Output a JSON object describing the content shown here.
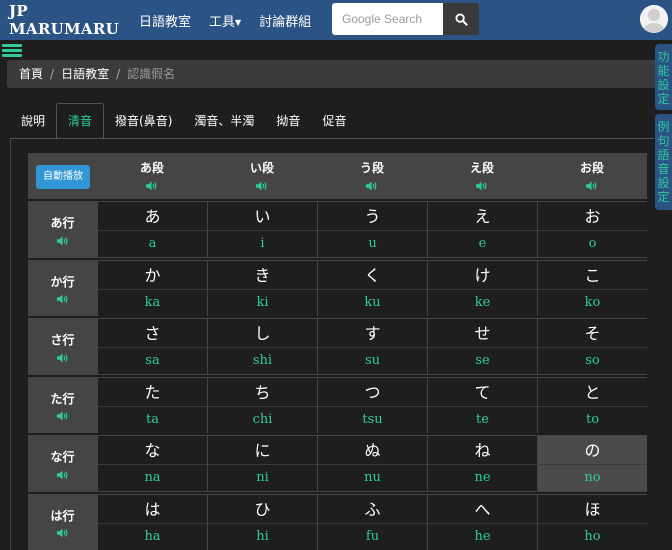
{
  "navbar": {
    "brand": "JP MARUMARU",
    "links": [
      "日語教室",
      "工具",
      "討論群組"
    ],
    "search_placeholder": "Google Search"
  },
  "breadcrumb": {
    "home": "首頁",
    "section": "日語教室",
    "current": "認識假名"
  },
  "side_panels": [
    {
      "label": "功能設定"
    },
    {
      "label": "例句語音設定"
    }
  ],
  "tabs": [
    "說明",
    "清音",
    "撥音(鼻音)",
    "濁音、半濁",
    "拗音",
    "促音"
  ],
  "active_tab": "清音",
  "kana_table": {
    "autoplay_label": "自動播放",
    "columns": [
      "あ段",
      "い段",
      "う段",
      "え段",
      "お段"
    ],
    "rows": [
      {
        "label": "あ行",
        "cells": [
          {
            "kana": "あ",
            "romaji": "a"
          },
          {
            "kana": "い",
            "romaji": "i"
          },
          {
            "kana": "う",
            "romaji": "u"
          },
          {
            "kana": "え",
            "romaji": "e"
          },
          {
            "kana": "お",
            "romaji": "o"
          }
        ]
      },
      {
        "label": "か行",
        "cells": [
          {
            "kana": "か",
            "romaji": "ka"
          },
          {
            "kana": "き",
            "romaji": "ki"
          },
          {
            "kana": "く",
            "romaji": "ku"
          },
          {
            "kana": "け",
            "romaji": "ke"
          },
          {
            "kana": "こ",
            "romaji": "ko"
          }
        ]
      },
      {
        "label": "さ行",
        "cells": [
          {
            "kana": "さ",
            "romaji": "sa"
          },
          {
            "kana": "し",
            "romaji": "shi"
          },
          {
            "kana": "す",
            "romaji": "su"
          },
          {
            "kana": "せ",
            "romaji": "se"
          },
          {
            "kana": "そ",
            "romaji": "so"
          }
        ]
      },
      {
        "label": "た行",
        "cells": [
          {
            "kana": "た",
            "romaji": "ta"
          },
          {
            "kana": "ち",
            "romaji": "chi"
          },
          {
            "kana": "つ",
            "romaji": "tsu"
          },
          {
            "kana": "て",
            "romaji": "te"
          },
          {
            "kana": "と",
            "romaji": "to"
          }
        ]
      },
      {
        "label": "な行",
        "cells": [
          {
            "kana": "な",
            "romaji": "na"
          },
          {
            "kana": "に",
            "romaji": "ni"
          },
          {
            "kana": "ぬ",
            "romaji": "nu"
          },
          {
            "kana": "ね",
            "romaji": "ne"
          },
          {
            "kana": "の",
            "romaji": "no"
          }
        ]
      },
      {
        "label": "は行",
        "cells": [
          {
            "kana": "は",
            "romaji": "ha"
          },
          {
            "kana": "ひ",
            "romaji": "hi"
          },
          {
            "kana": "ふ",
            "romaji": "fu"
          },
          {
            "kana": "へ",
            "romaji": "he"
          },
          {
            "kana": "ほ",
            "romaji": "ho"
          }
        ]
      }
    ],
    "highlighted_cell": "の"
  },
  "colors": {
    "navbar": "#2b5384",
    "accent": "#2ecc9a",
    "autoplay_button": "#3296d6",
    "background": "#1e1e1e",
    "header_bg": "#454545"
  },
  "icons": [
    "hamburger-menu-icon",
    "search-icon",
    "user-avatar-icon",
    "speaker-icon"
  ]
}
